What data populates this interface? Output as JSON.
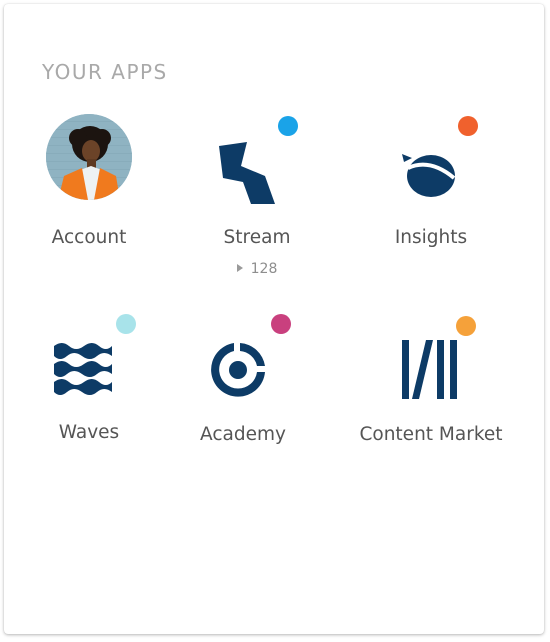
{
  "section": {
    "title": "YOUR APPS"
  },
  "apps": [
    {
      "label": "Account"
    },
    {
      "label": "Stream",
      "count": "128",
      "dot_color": "#1aa3e8",
      "icon": "stream-icon"
    },
    {
      "label": "Insights",
      "dot_color": "#f0612d",
      "icon": "acorn-icon"
    },
    {
      "label": "Waves",
      "dot_color": "#a8e3ea",
      "icon": "waves-icon"
    },
    {
      "label": "Academy",
      "dot_color": "#c9407e",
      "icon": "target-icon"
    },
    {
      "label": "Content Market",
      "dot_color": "#f5a13a",
      "icon": "bars-icon"
    }
  ],
  "colors": {
    "brand": "#0d3b66",
    "label": "#555555",
    "heading": "#a9a9a9"
  }
}
